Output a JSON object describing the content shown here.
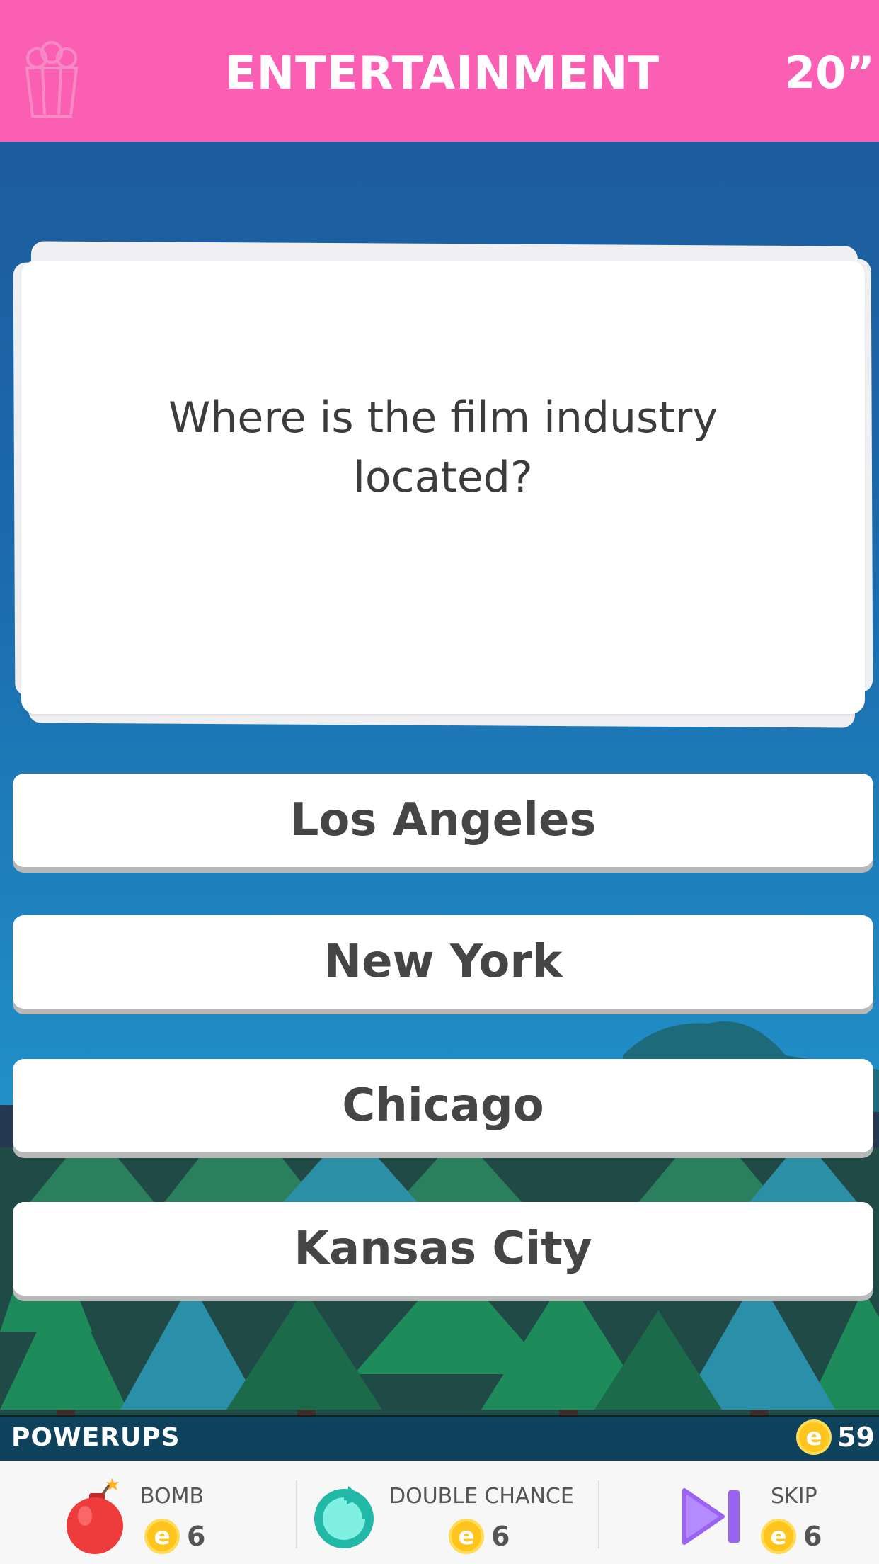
{
  "header": {
    "category": "ENTERTAINMENT",
    "timer": "20”",
    "category_icon": "popcorn-icon",
    "colors": {
      "bar": "#fb5fb4",
      "text": "#ffffff"
    }
  },
  "question": {
    "text": "Where is the film industry located?"
  },
  "answers": [
    {
      "label": "Los Angeles"
    },
    {
      "label": "New York"
    },
    {
      "label": "Chicago"
    },
    {
      "label": "Kansas City"
    }
  ],
  "powerups_bar": {
    "label": "POWERUPS",
    "coins": "59",
    "coin_symbol": "e",
    "coin_color": "#ffc51c"
  },
  "powerups": [
    {
      "name": "BOMB",
      "cost": "6",
      "icon": "bomb-icon",
      "color": "#ee3b3b"
    },
    {
      "name": "DOUBLE CHANCE",
      "cost": "6",
      "icon": "double-chance-icon",
      "color": "#2fd3c2"
    },
    {
      "name": "SKIP",
      "cost": "6",
      "icon": "skip-icon",
      "color": "#9a63f2"
    }
  ]
}
